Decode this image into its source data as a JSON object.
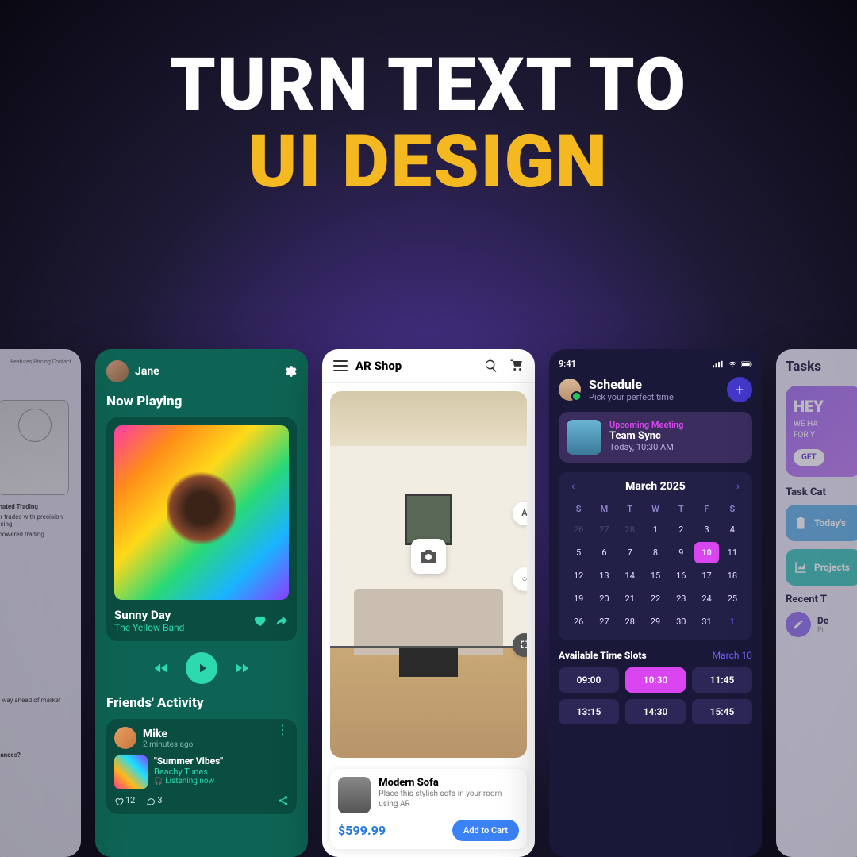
{
  "hero": {
    "line1": "TURN TEXT TO",
    "line2": "UI DESIGN"
  },
  "web": {
    "nav": "Features  Pricing  Contact",
    "headline": "mated Trading",
    "sub": "ur trades with precision using",
    "sub2": "-powered trading",
    "q": "nances?",
    "foot": "a way ahead of market"
  },
  "music": {
    "user": "Jane",
    "now_playing": "Now Playing",
    "song": "Sunny Day",
    "artist": "The Yellow Band",
    "friends_title": "Friends' Activity",
    "friend": {
      "name": "Mike",
      "ago": "2 minutes ago",
      "song": "\"Summer Vibes\"",
      "artist": "Beachy Tunes",
      "status": "Listening now"
    },
    "likes": "12",
    "comments": "3"
  },
  "shop": {
    "title": "AR Shop",
    "product": {
      "name": "Modern Sofa",
      "desc": "Place this stylish sofa in your room using AR",
      "price": "$599.99",
      "cta": "Add to Cart"
    }
  },
  "sched": {
    "time": "9:41",
    "title": "Schedule",
    "subtitle": "Pick your perfect time",
    "meeting": {
      "label": "Upcoming Meeting",
      "title": "Team Sync",
      "datetime": "Today, 10:30 AM"
    },
    "month": "March 2025",
    "dow": [
      "S",
      "M",
      "T",
      "W",
      "T",
      "F",
      "S"
    ],
    "days": [
      {
        "n": "26",
        "c": "prev"
      },
      {
        "n": "27",
        "c": "prev"
      },
      {
        "n": "28",
        "c": "prev"
      },
      {
        "n": "1"
      },
      {
        "n": "2"
      },
      {
        "n": "3"
      },
      {
        "n": "4"
      },
      {
        "n": "5"
      },
      {
        "n": "6"
      },
      {
        "n": "7"
      },
      {
        "n": "8"
      },
      {
        "n": "9"
      },
      {
        "n": "10",
        "c": "sel"
      },
      {
        "n": "11"
      },
      {
        "n": "12"
      },
      {
        "n": "13"
      },
      {
        "n": "14"
      },
      {
        "n": "15"
      },
      {
        "n": "16"
      },
      {
        "n": "17"
      },
      {
        "n": "18"
      },
      {
        "n": "19"
      },
      {
        "n": "20"
      },
      {
        "n": "21"
      },
      {
        "n": "22"
      },
      {
        "n": "23"
      },
      {
        "n": "24"
      },
      {
        "n": "25"
      },
      {
        "n": "26"
      },
      {
        "n": "27"
      },
      {
        "n": "28"
      },
      {
        "n": "29"
      },
      {
        "n": "30"
      },
      {
        "n": "31"
      },
      {
        "n": "1",
        "c": "next"
      }
    ],
    "slots_title": "Available Time Slots",
    "slots_date": "March 10",
    "slots": [
      {
        "t": "09:00"
      },
      {
        "t": "10:30",
        "sel": true
      },
      {
        "t": "11:45"
      },
      {
        "t": "13:15"
      },
      {
        "t": "14:30"
      },
      {
        "t": "15:45"
      }
    ]
  },
  "tasks": {
    "title": "Tasks",
    "hey": {
      "h": "HEY",
      "s1": "WE HA",
      "s2": "FOR Y",
      "btn": "GET"
    },
    "cat_title": "Task Cat",
    "cats": [
      {
        "t": "Today's"
      },
      {
        "t": "Projects"
      }
    ],
    "recent_title": "Recent T",
    "recent": {
      "t": "De",
      "s": "Pr"
    }
  }
}
